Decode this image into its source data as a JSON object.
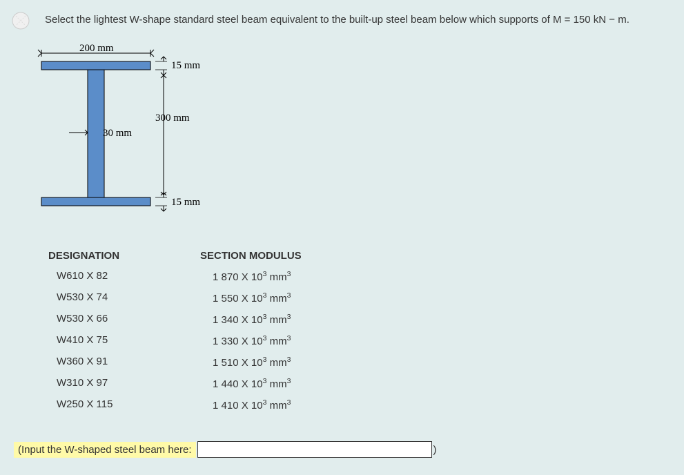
{
  "question": "Select the lightest W-shape standard steel beam equivalent to the built-up steel beam below which supports of M = 150 kN − m.",
  "diagram": {
    "flange_width": "200 mm",
    "flange_thickness": "15 mm",
    "web_height": "300 mm",
    "web_thickness": "30 mm",
    "bottom_flange_thickness": "15 mm"
  },
  "table": {
    "header_designation": "DESIGNATION",
    "header_modulus": "SECTION MODULUS",
    "rows": [
      {
        "designation": "W610 X 82",
        "modulus_val": "1 870",
        "modulus_unit": " X 10",
        "exp": "3",
        "tail": " mm",
        "exp2": "3"
      },
      {
        "designation": "W530 X 74",
        "modulus_val": "1 550",
        "modulus_unit": " X 10",
        "exp": "3",
        "tail": " mm",
        "exp2": "3"
      },
      {
        "designation": "W530 X 66",
        "modulus_val": "1 340",
        "modulus_unit": " X 10",
        "exp": "3",
        "tail": " mm",
        "exp2": "3"
      },
      {
        "designation": "W410 X 75",
        "modulus_val": "1 330",
        "modulus_unit": " X 10",
        "exp": "3",
        "tail": " mm",
        "exp2": "3"
      },
      {
        "designation": "W360 X 91",
        "modulus_val": "1 510",
        "modulus_unit": " X 10",
        "exp": "3",
        "tail": " mm",
        "exp2": "3"
      },
      {
        "designation": "W310 X 97",
        "modulus_val": "1 440",
        "modulus_unit": " X 10",
        "exp": "3",
        "tail": " mm",
        "exp2": "3"
      },
      {
        "designation": "W250 X 115",
        "modulus_val": "1 410",
        "modulus_unit": " X 10",
        "exp": "3",
        "tail": " mm",
        "exp2": "3"
      }
    ]
  },
  "input_label": "(Input the W-shaped steel beam here:",
  "paren_close": ")"
}
